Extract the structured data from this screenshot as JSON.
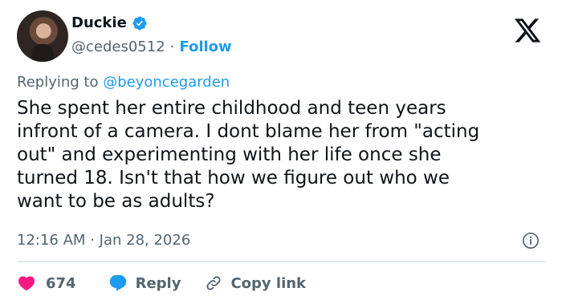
{
  "author": {
    "display_name": "Duckie",
    "handle": "@cedes0512",
    "separator": "·",
    "follow_label": "Follow"
  },
  "reply_context": {
    "prefix": "Replying to",
    "mention": "@beyoncegarden"
  },
  "tweet": {
    "text": "She spent her entire childhood and teen years\ninfront of a camera. I dont blame her from \"acting\nout\" and experimenting with her life once she\nturned 18.  Isn't that how we figure out who we\nwant to be as adults?",
    "time": "12:16 AM",
    "separator": "·",
    "date": "Jan 28, 2026"
  },
  "actions": {
    "like_count": "674",
    "reply_label": "Reply",
    "copy_link_label": "Copy link"
  },
  "colors": {
    "accent": "#1d9bf0",
    "like": "#f91880",
    "muted_text": "#536471",
    "text": "#0f1419",
    "divider": "#cfd9de"
  },
  "icons": [
    "verified-badge-icon",
    "x-logo-icon",
    "info-icon",
    "heart-icon",
    "reply-bubble-icon",
    "link-icon"
  ]
}
